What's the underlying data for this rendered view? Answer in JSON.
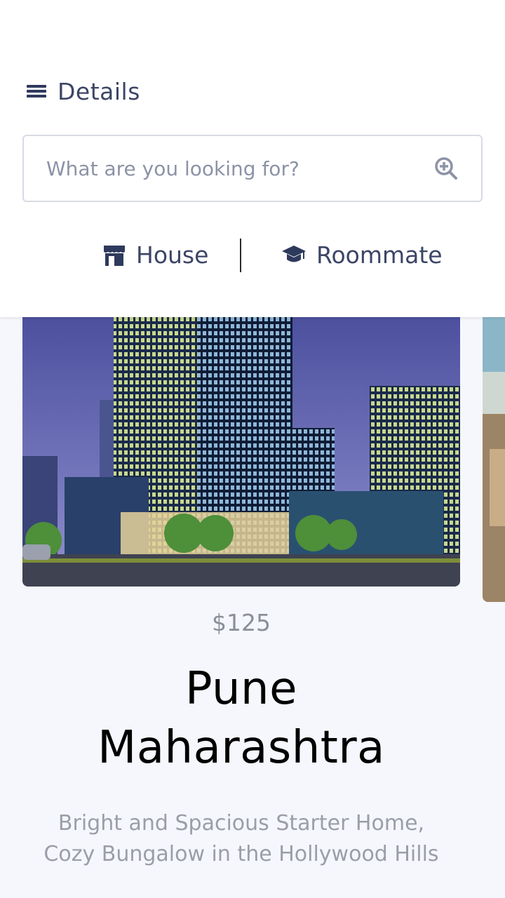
{
  "header": {
    "menu_title": "Details"
  },
  "search": {
    "placeholder": "What are you looking for?",
    "value": ""
  },
  "tabs": [
    {
      "label": "House",
      "icon": "store-icon"
    },
    {
      "label": "Roommate",
      "icon": "graduation-cap-icon"
    }
  ],
  "listing": {
    "price": "$125",
    "title_line1": "Pune",
    "title_line2": "Maharashtra",
    "description": "Bright and Spacious Starter Home, Cozy Bungalow in the Hollywood Hills"
  },
  "colors": {
    "primary_text": "#3c4566",
    "icon": "#2e3a5c",
    "muted": "#8a8f99",
    "background": "#f6f7fc"
  }
}
